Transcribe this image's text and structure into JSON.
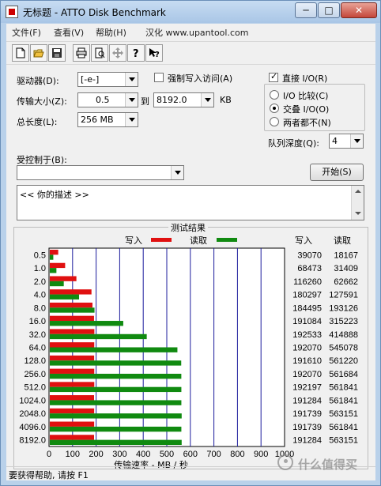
{
  "window": {
    "title": "无标题 - ATTO Disk Benchmark",
    "min_glyph": "─",
    "max_glyph": "□",
    "close_glyph": "✕"
  },
  "menu": [
    {
      "label": "文件(F)"
    },
    {
      "label": "查看(V)"
    },
    {
      "label": "帮助(H)"
    },
    {
      "label": "汉化 www.upantool.com"
    }
  ],
  "toolbar": [
    {
      "icon": "new-file-icon"
    },
    {
      "icon": "open-folder-icon"
    },
    {
      "icon": "save-icon"
    },
    {
      "icon": "print-icon"
    },
    {
      "icon": "print-preview-icon"
    },
    {
      "icon": "move-icon"
    },
    {
      "icon": "help-icon"
    },
    {
      "icon": "context-help-icon"
    }
  ],
  "settings": {
    "drive_label": "驱动器(D):",
    "drive_value": "[-e-]",
    "transfer_label": "传输大小(Z):",
    "transfer_from": "0.5",
    "to_label": "到",
    "transfer_to": "8192.0",
    "kb_label": "KB",
    "total_label": "总长度(L):",
    "total_value": "256 MB",
    "force_write_label": "强制写入访问(A)",
    "force_write_checked": false,
    "direct_io_label": "直接 I/O(R)",
    "direct_io_checked": true,
    "io_compare_label": "I/O 比较(C)",
    "overlapped_io_label": "交叠 I/O(O)",
    "neither_label": "两者都不(N)",
    "selected_mode": "overlapped",
    "queue_label": "队列深度(Q):",
    "queue_value": "4",
    "controlled_label": "受控制于(B):",
    "controlled_value": "",
    "start_label": "开始(S)",
    "description": "<< 你的描述 >>"
  },
  "results": {
    "title": "测试结果",
    "write_label": "写入",
    "read_label": "读取",
    "write_col_header": "写入",
    "read_col_header": "读取",
    "write_color": "#e01010",
    "read_color": "#108a10"
  },
  "chart_data": {
    "type": "bar",
    "orientation": "horizontal",
    "title": "测试结果",
    "xlabel": "传输速率 - MB / 秒",
    "ylabel": "",
    "xlim": [
      0,
      1000
    ],
    "xticks": [
      0,
      100,
      200,
      300,
      400,
      500,
      600,
      700,
      800,
      900,
      1000
    ],
    "grid": true,
    "legend": "top",
    "categories": [
      "0.5",
      "1.0",
      "2.0",
      "4.0",
      "8.0",
      "16.0",
      "32.0",
      "64.0",
      "128.0",
      "256.0",
      "512.0",
      "1024.0",
      "2048.0",
      "4096.0",
      "8192.0"
    ],
    "series": [
      {
        "name": "写入",
        "values": [
          39.07,
          68.473,
          116.26,
          180.297,
          184.495,
          191.084,
          192.533,
          192.07,
          191.61,
          192.07,
          192.197,
          191.284,
          191.739,
          191.739,
          191.284
        ]
      },
      {
        "name": "读取",
        "values": [
          18.167,
          31.409,
          62.662,
          127.591,
          193.126,
          315.223,
          414.888,
          545.078,
          561.22,
          561.684,
          561.841,
          561.841,
          563.151,
          561.841,
          563.151
        ]
      }
    ],
    "write_kb": [
      "39070",
      "68473",
      "116260",
      "180297",
      "184495",
      "191084",
      "192533",
      "192070",
      "191610",
      "192070",
      "192197",
      "191284",
      "191739",
      "191739",
      "191284"
    ],
    "read_kb": [
      "18167",
      "31409",
      "62662",
      "127591",
      "193126",
      "315223",
      "414888",
      "545078",
      "561220",
      "561684",
      "561841",
      "561841",
      "563151",
      "561841",
      "563151"
    ]
  },
  "status": {
    "text": "要获得帮助, 请按 F1"
  },
  "watermark": {
    "text": "什么值得买"
  }
}
